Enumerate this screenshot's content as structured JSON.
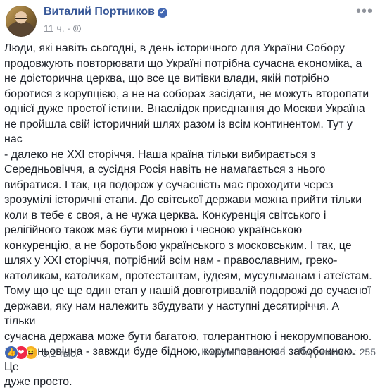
{
  "post": {
    "author": "Виталий Портников",
    "verified_icon": "verified-badge-icon",
    "time": "11 ч.",
    "separator": "·",
    "audience_icon": "globe-icon",
    "more_icon": "more-options-icon",
    "text": "Люди, які навіть сьогодні, в день історичного для України Собору\nпродовжують повторювати що Україні потрібна сучасна економіка, а\nне доісторична церква, що все це витівки влади, якій потрібно\nборотися з корупцією, а не на соборах засідати, не можуть второпати\nоднієї дуже простої істини. Внаслідок приєднання до Москви Україна\nне пройшла свій історичний шлях разом із всім континентом. Тут у нас\n- далеко не ХХІ сторіччя. Наша країна тільки вибирається з\nСередньовіччя, а сусідня Росія навіть не намагається з нього\nвибратися. І так, ця подорож у сучасність має проходити через\nзрозумілі історичні етапи. До світської держави можна прийти тільки\nколи в тебе є своя, а не чужа церква. Конкуренція світського і\nрелігійного також має бути мирною і чесною українською\nконкуренцію, а не боротьбою українського з московським. І так, це\nшлях у ХХІ сторіччя, потрібний всім нам - православним, греко-\nкатоликам, католикам, протестантам, іудеям, мусульманам і атеїстам.\nТому що це ще один етап у нашій довготривалій подорожі до сучасної\nдержави, яку нам належить збудувати у наступні десятиріччя. А тільки\nсучасна держава може бути багатою, толерантною і некорумпованою.\nСередньовічна - завжди буде бідною, корумпованою і забобонною. Це\nдуже просто."
  },
  "footer": {
    "reaction_icons": [
      "like-icon",
      "love-icon",
      "haha-icon"
    ],
    "reactions_count": "3,1 тыс.",
    "comments": "Комментарии: 146",
    "shares": "Поделились: 255"
  },
  "colors": {
    "author": "#385898",
    "meta": "#90949c",
    "text": "#1d2129",
    "like": "#4267b2",
    "love": "#f0284a",
    "haha": "#f7b125"
  }
}
